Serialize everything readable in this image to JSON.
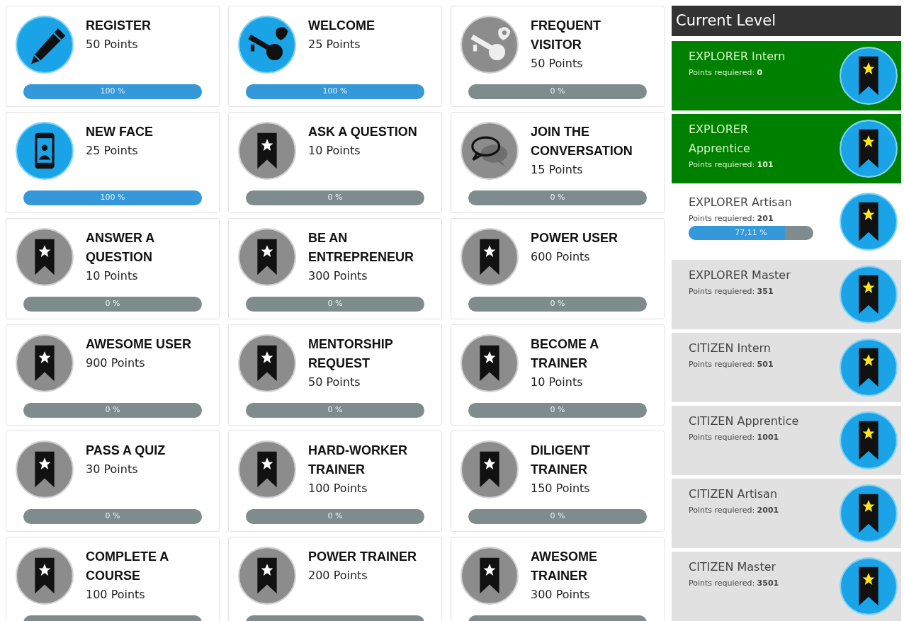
{
  "badges": [
    {
      "title": "REGISTER",
      "points": "50 Points",
      "kind": "pencil",
      "earned": true,
      "level": 1,
      "percent": "100 %"
    },
    {
      "title": "WELCOME",
      "points": "25 Points",
      "kind": "key",
      "earned": true,
      "level": 1,
      "percent": "100 %"
    },
    {
      "title": "FREQUENT VISITOR",
      "points": "50 Points",
      "kind": "key",
      "earned": false,
      "level": 0,
      "percent": "0 %"
    },
    {
      "title": "NEW FACE",
      "points": "25 Points",
      "kind": "phone",
      "earned": true,
      "level": 1,
      "percent": "100 %"
    },
    {
      "title": "ASK A QUESTION",
      "points": "10 Points",
      "kind": "ribbon",
      "earned": false,
      "level": 0,
      "percent": "0 %"
    },
    {
      "title": "JOIN THE CONVERSATION",
      "points": "15 Points",
      "kind": "chat",
      "earned": false,
      "level": 0,
      "percent": "0 %"
    },
    {
      "title": "ANSWER A QUESTION",
      "points": "10 Points",
      "kind": "ribbon",
      "earned": false,
      "level": 0,
      "percent": "0 %"
    },
    {
      "title": "BE AN ENTREPRENEUR",
      "points": "300 Points",
      "kind": "ribbon",
      "earned": false,
      "level": 0,
      "percent": "0 %"
    },
    {
      "title": "POWER USER",
      "points": "600 Points",
      "kind": "ribbon",
      "earned": false,
      "level": 0,
      "percent": "0 %"
    },
    {
      "title": "AWESOME USER",
      "points": "900 Points",
      "kind": "ribbon",
      "earned": false,
      "level": 0,
      "percent": "0 %"
    },
    {
      "title": "MENTORSHIP REQUEST",
      "points": "50 Points",
      "kind": "ribbon",
      "earned": false,
      "level": 0,
      "percent": "0 %"
    },
    {
      "title": "BECOME A TRAINER",
      "points": "10 Points",
      "kind": "ribbon",
      "earned": false,
      "level": 0,
      "percent": "0 %"
    },
    {
      "title": "PASS A QUIZ",
      "points": "30 Points",
      "kind": "ribbon",
      "earned": false,
      "level": 0,
      "percent": "0 %"
    },
    {
      "title": "HARD-WORKER TRAINER",
      "points": "100 Points",
      "kind": "ribbon",
      "earned": false,
      "level": 0,
      "percent": "0 %"
    },
    {
      "title": "DILIGENT TRAINER",
      "points": "150 Points",
      "kind": "ribbon",
      "earned": false,
      "level": 0,
      "percent": "0 %"
    },
    {
      "title": "COMPLETE A COURSE",
      "points": "100 Points",
      "kind": "ribbon",
      "earned": false,
      "level": 0
    },
    {
      "title": "POWER TRAINER",
      "points": "200 Points",
      "kind": "ribbon",
      "earned": false,
      "level": 0
    },
    {
      "title": "AWESOME TRAINER",
      "points": "300 Points",
      "kind": "ribbon",
      "earned": false,
      "level": 0
    }
  ],
  "levels": {
    "title": "Current Level",
    "items": [
      {
        "name": "EXPLORER Intern",
        "label": "Points requiered:",
        "points": "0",
        "kind": "reached"
      },
      {
        "name": "EXPLORER Apprentice",
        "label": "Points requiered:",
        "points": "101",
        "kind": "reached"
      },
      {
        "name": "EXPLORER Artisan",
        "label": "Points requiered:",
        "points": "201",
        "kind": "current",
        "level": 0.7711,
        "reading": "77,11 %"
      },
      {
        "name": "EXPLORER Master",
        "label": "Points requiered:",
        "points": "351",
        "kind": "locked"
      },
      {
        "name": "CITIZEN Intern",
        "label": "Points requiered:",
        "points": "501",
        "kind": "locked"
      },
      {
        "name": "CITIZEN Apprentice",
        "label": "Points requiered:",
        "points": "1001",
        "kind": "locked"
      },
      {
        "name": "CITIZEN Artisan",
        "label": "Points requiered:",
        "points": "2001",
        "kind": "locked"
      },
      {
        "name": "CITIZEN Master",
        "label": "Points requiered:",
        "points": "3501",
        "kind": "locked"
      }
    ]
  }
}
